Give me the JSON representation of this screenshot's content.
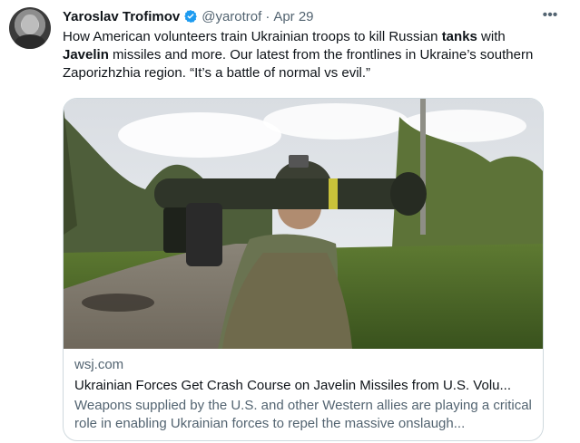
{
  "tweet": {
    "author_name": "Yaroslav Trofimov",
    "handle": "@yarotrof",
    "separator": "·",
    "date": "Apr 29",
    "more_icon": "more-icon",
    "text_parts": {
      "p1": "How American volunteers train Ukrainian troops to kill Russian ",
      "b1": "tanks",
      "p2": " with ",
      "b2": "Javelin",
      "p3": " missiles and more. Our latest from the frontlines in Ukraine’s southern Zaporizhzhia region. “It’s a battle of normal vs evil.”"
    }
  },
  "card": {
    "domain": "wsj.com",
    "title": "Ukrainian Forces Get Crash Course on Javelin Missiles from U.S. Volu...",
    "description": "Weapons supplied by the U.S. and other Western allies are playing a critical role in enabling Ukrainian forces to repel the massive onslaugh..."
  },
  "colors": {
    "verified_blue": "#1d9bf0",
    "secondary_text": "#536471"
  }
}
